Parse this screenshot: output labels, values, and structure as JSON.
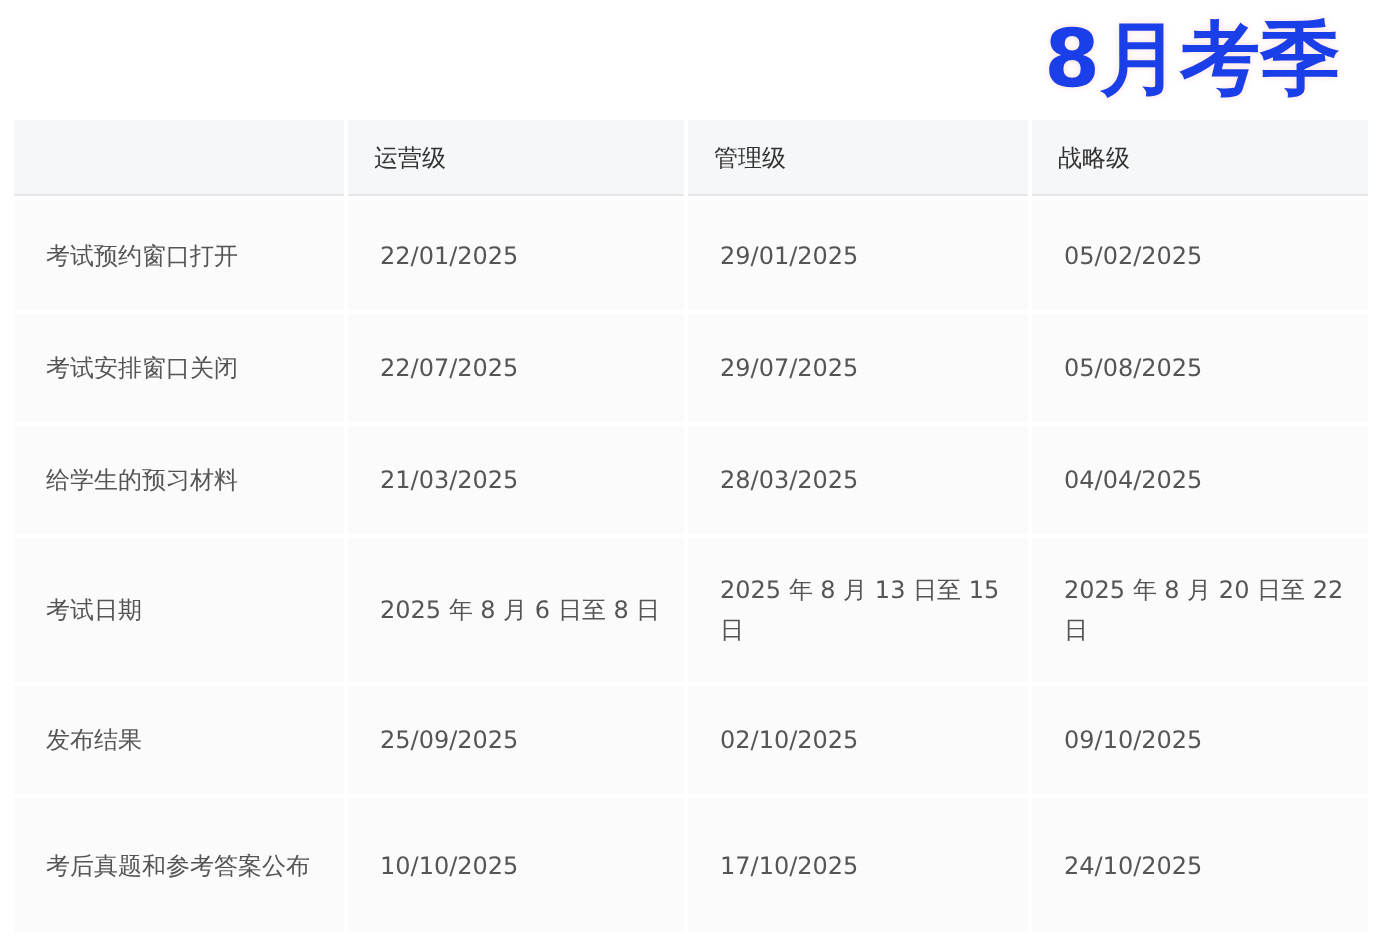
{
  "title": "8月考季",
  "table": {
    "columns": [
      "",
      "运营级",
      "管理级",
      "战略级"
    ],
    "rows": [
      [
        "考试预约窗口打开",
        "22/01/2025",
        "29/01/2025",
        "05/02/2025"
      ],
      [
        "考试安排窗口关闭",
        "22/07/2025",
        "29/07/2025",
        "05/08/2025"
      ],
      [
        "给学生的预习材料",
        "21/03/2025",
        "28/03/2025",
        "04/04/2025"
      ],
      [
        "考试日期",
        "2025 年 8 月 6 日至 8 日",
        "2025 年 8 月 13 日至 15 日",
        "2025 年 8 月 20 日至 22 日"
      ],
      [
        "发布结果",
        "25/09/2025",
        "02/10/2025",
        "09/10/2025"
      ],
      [
        "考后真题和参考答案公布",
        "10/10/2025",
        "17/10/2025",
        "24/10/2025"
      ]
    ]
  }
}
